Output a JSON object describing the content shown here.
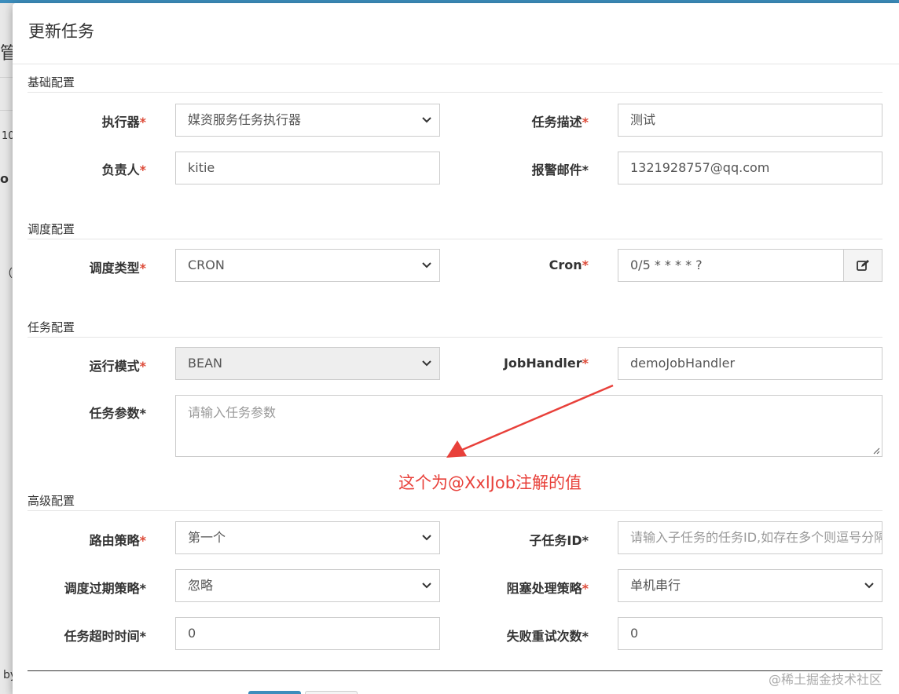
{
  "background": {
    "fragments": [
      "管",
      "10",
      "o",
      "（ /",
      "by"
    ]
  },
  "modal": {
    "title": "更新任务",
    "required_mark": "*",
    "sections": {
      "basic": "基础配置",
      "schedule": "调度配置",
      "job": "任务配置",
      "advanced": "高级配置"
    },
    "fields": {
      "executor": {
        "label": "执行器",
        "value": "媒资服务任务执行器"
      },
      "job_desc": {
        "label": "任务描述",
        "value": "测试"
      },
      "author": {
        "label": "负责人",
        "value": "kitie"
      },
      "alarm_email": {
        "label": "报警邮件",
        "value": "1321928757@qq.com"
      },
      "schedule_type": {
        "label": "调度类型",
        "value": "CRON"
      },
      "cron": {
        "label": "Cron",
        "value": "0/5 * * * * ?"
      },
      "run_mode": {
        "label": "运行模式",
        "value": "BEAN"
      },
      "job_handler": {
        "label": "JobHandler",
        "value": "demoJobHandler"
      },
      "job_params": {
        "label": "任务参数",
        "placeholder": "请输入任务参数"
      },
      "route_strategy": {
        "label": "路由策略",
        "value": "第一个"
      },
      "child_job_id": {
        "label": "子任务ID",
        "placeholder": "请输入子任务的任务ID,如存在多个则逗号分隔"
      },
      "misfire_strategy": {
        "label": "调度过期策略",
        "value": "忽略"
      },
      "block_strategy": {
        "label": "阻塞处理策略",
        "value": "单机串行"
      },
      "timeout": {
        "label": "任务超时时间",
        "value": "0"
      },
      "fail_retry": {
        "label": "失败重试次数",
        "value": "0"
      }
    },
    "annotation": "这个为@XxlJob注解的值"
  },
  "watermark": "@稀土掘金技术社区",
  "colors": {
    "required": "#dd4b39",
    "annotation": "#e8403a",
    "primary": "#3c8dbc"
  }
}
